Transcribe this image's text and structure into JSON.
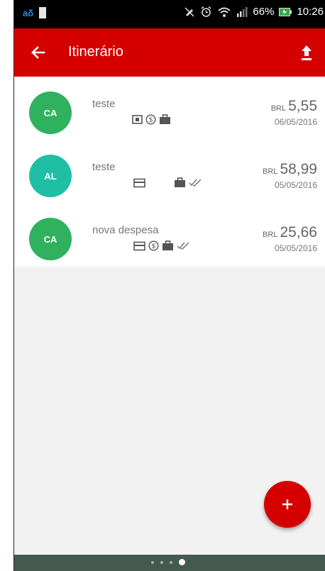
{
  "status_bar": {
    "battery_percent": "66%",
    "time": "10:26"
  },
  "app_bar": {
    "title": "Itinerário"
  },
  "expenses": [
    {
      "initials": "CA",
      "avatar_color": "#2fb15e",
      "name": "teste",
      "currency": "BRL",
      "amount": "5,55",
      "date": "06/05/2016",
      "icons": [
        "receipt-icon",
        "money-icon",
        "briefcase-icon"
      ]
    },
    {
      "initials": "AL",
      "avatar_color": "#1fbfa6",
      "name": "teste",
      "currency": "BRL",
      "amount": "58,99",
      "date": "05/05/2016",
      "icons": [
        "credit-card-icon",
        "briefcase-icon",
        "double-check-icon"
      ]
    },
    {
      "initials": "CA",
      "avatar_color": "#2fb15e",
      "name": "nova despesa",
      "currency": "BRL",
      "amount": "25,66",
      "date": "05/05/2016",
      "icons": [
        "credit-card-icon",
        "money-icon",
        "briefcase-icon",
        "double-check-icon"
      ]
    }
  ],
  "fab": {
    "icon": "plus-icon"
  },
  "page_indicator": {
    "pages": 4,
    "current": 4
  },
  "colors": {
    "brand": "#d50000"
  }
}
